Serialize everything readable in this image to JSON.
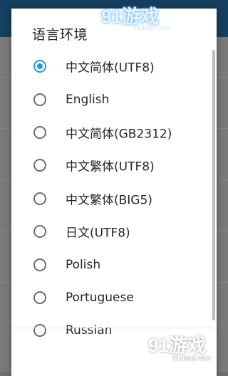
{
  "dialog": {
    "title": "语言环境",
    "options": [
      {
        "label": "中文简体(UTF8)",
        "selected": true
      },
      {
        "label": "English",
        "selected": false
      },
      {
        "label": "中文简体(GB2312)",
        "selected": false
      },
      {
        "label": "中文繁体(UTF8)",
        "selected": false
      },
      {
        "label": "中文繁体(BIG5)",
        "selected": false
      },
      {
        "label": "日文(UTF8)",
        "selected": false
      },
      {
        "label": "Polish",
        "selected": false
      },
      {
        "label": "Portuguese",
        "selected": false
      },
      {
        "label": "Russian",
        "selected": false
      }
    ]
  },
  "watermarks": {
    "top_logo": "91游戏",
    "top_site": "91danji.com",
    "bottom_logo": "91游戏",
    "bottom_site": "91danji.com"
  },
  "colors": {
    "accent": "#1e9fdc",
    "topbar": "#173f5f",
    "dim_background": "#7a7a7a"
  }
}
